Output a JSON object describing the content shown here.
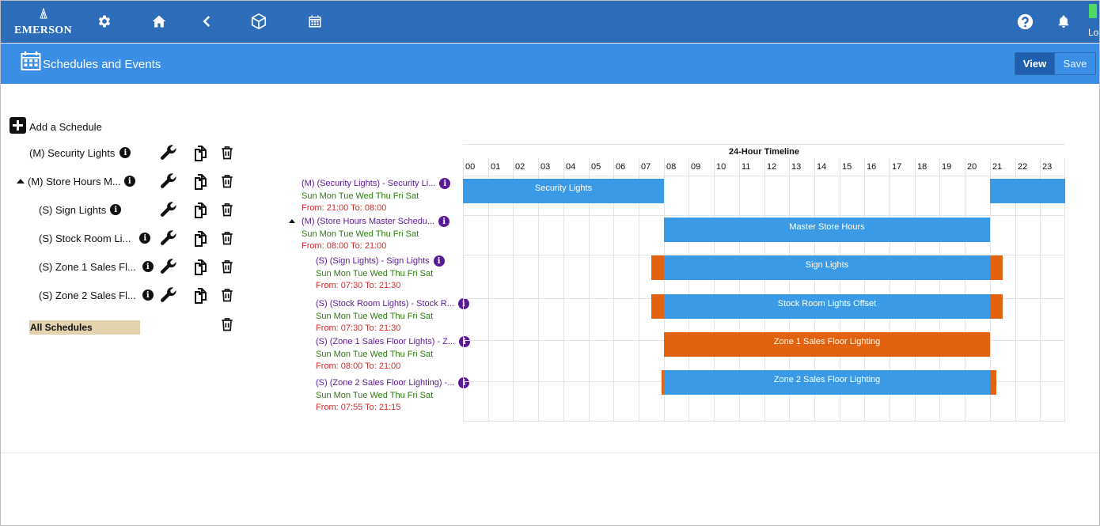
{
  "app": {
    "brand": "EMERSON",
    "user_short": "Lo"
  },
  "header": {
    "title": "Schedules and Events",
    "view_label": "View",
    "save_label": "Save"
  },
  "colors": {
    "top_bar": "#2d6cb9",
    "sub_bar": "#3a8ee6",
    "bar_blue": "#3a9ae6",
    "bar_orange": "#e2620f",
    "title_purple": "#5a1a96",
    "days_green": "#2d7a10",
    "time_red": "#d42b2b",
    "all_schedules_bg": "#e2d3ae"
  },
  "sidebar": {
    "add_label": "Add a Schedule",
    "items": [
      {
        "label": "(M) Security Lights",
        "icon": "info-icon"
      },
      {
        "label": "(M) Store Hours M...",
        "icon": "info-icon",
        "expanded": true
      },
      {
        "label": "(S) Sign Lights",
        "icon": "info-icon"
      },
      {
        "label": "(S) Stock Room Li...",
        "icon": "info-icon"
      },
      {
        "label": "(S) Zone 1 Sales Fl...",
        "icon": "info-icon"
      },
      {
        "label": "(S) Zone 2 Sales Fl...",
        "icon": "info-icon"
      }
    ],
    "all_label": "All Schedules"
  },
  "rows": [
    {
      "title": "(M) (Security Lights) - Security Li...",
      "days": "Sun Mon Tue Wed Thu Fri Sat",
      "time": "From: 21:00 To: 08:00",
      "bar_label": "Security Lights"
    },
    {
      "title": "(M) (Store Hours Master Schedu...",
      "days": "Sun Mon Tue Wed Thu Fri Sat",
      "time": "From: 08:00 To: 21:00",
      "bar_label": "Master Store Hours"
    },
    {
      "title": "(S) (Sign Lights) - Sign Lights",
      "days": "Sun Mon Tue Wed Thu Fri Sat",
      "time": "From: 07:30 To: 21:30",
      "bar_label": "Sign Lights"
    },
    {
      "title": "(S) (Stock Room Lights) - Stock R...",
      "days": "Sun Mon Tue Wed Thu Fri Sat",
      "time": "From: 07:30 To: 21:30",
      "bar_label": "Stock Room Lights Offset"
    },
    {
      "title": "(S) (Zone 1 Sales Floor Lights) - Z...",
      "days": "Sun Mon Tue Wed Thu Fri Sat",
      "time": "From: 08:00 To: 21:00",
      "bar_label": "Zone 1 Sales Floor Lighting"
    },
    {
      "title": "(S) (Zone 2 Sales Floor Lighting) -...",
      "days": "Sun Mon Tue Wed Thu Fri Sat",
      "time": "From: 07:55 To: 21:15",
      "bar_label": "Zone 2 Sales Floor Lighting"
    }
  ],
  "timeline": {
    "title": "24-Hour Timeline",
    "hours": [
      "00",
      "01",
      "02",
      "03",
      "04",
      "05",
      "06",
      "07",
      "08",
      "09",
      "10",
      "11",
      "12",
      "13",
      "14",
      "15",
      "16",
      "17",
      "18",
      "19",
      "20",
      "21",
      "22",
      "23"
    ]
  }
}
